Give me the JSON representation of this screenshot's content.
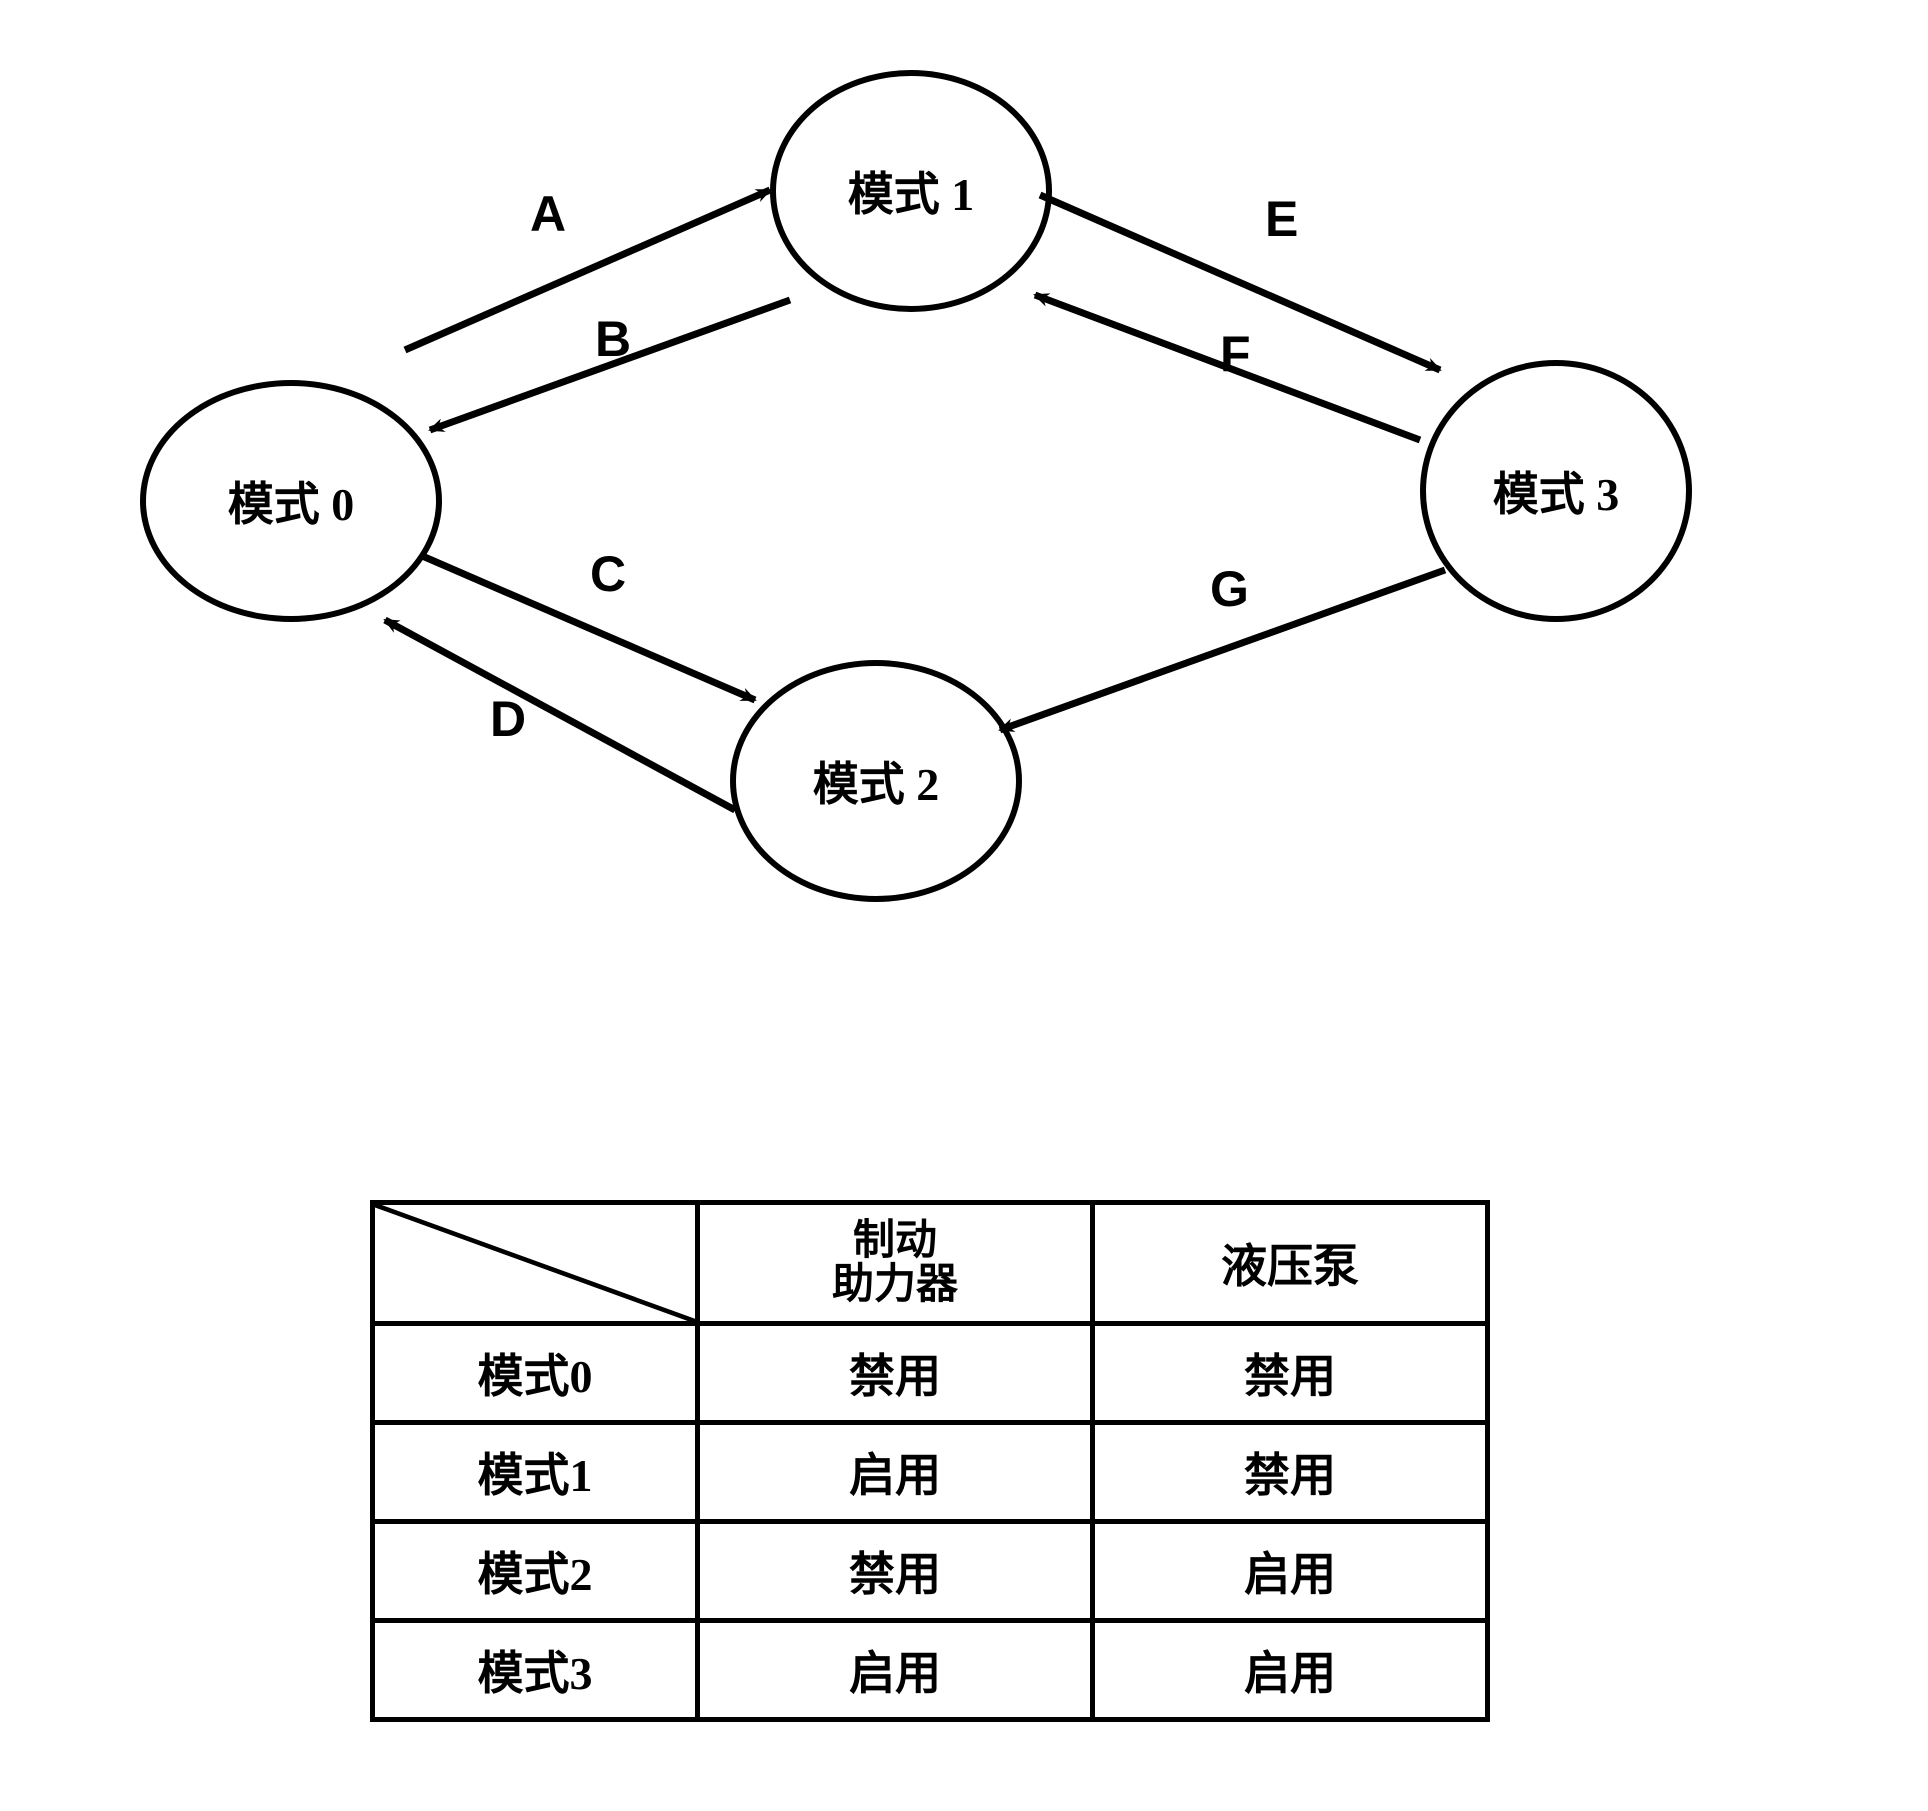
{
  "states": {
    "mode0": "模式 0",
    "mode1": "模式 1",
    "mode2": "模式 2",
    "mode3": "模式 3"
  },
  "edges": {
    "A": "A",
    "B": "B",
    "C": "C",
    "D": "D",
    "E": "E",
    "F": "F",
    "G": "G"
  },
  "table": {
    "headers": {
      "col1_blank": "",
      "brake_booster_line1": "制动",
      "brake_booster_line2": "助力器",
      "hydraulic_pump": "液压泵"
    },
    "rows": [
      {
        "mode": "模式0",
        "booster": "禁用",
        "pump": "禁用"
      },
      {
        "mode": "模式1",
        "booster": "启用",
        "pump": "禁用"
      },
      {
        "mode": "模式2",
        "booster": "禁用",
        "pump": "启用"
      },
      {
        "mode": "模式3",
        "booster": "启用",
        "pump": "启用"
      }
    ]
  },
  "chart_data": {
    "type": "state_diagram_with_table",
    "nodes": [
      "模式0",
      "模式1",
      "模式2",
      "模式3"
    ],
    "transitions": [
      {
        "label": "A",
        "from": "模式0",
        "to": "模式1"
      },
      {
        "label": "B",
        "from": "模式1",
        "to": "模式0"
      },
      {
        "label": "C",
        "from": "模式0",
        "to": "模式2"
      },
      {
        "label": "D",
        "from": "模式2",
        "to": "模式0"
      },
      {
        "label": "E",
        "from": "模式1",
        "to": "模式3"
      },
      {
        "label": "F",
        "from": "模式3",
        "to": "模式1"
      },
      {
        "label": "G",
        "from": "模式3",
        "to": "模式2"
      }
    ],
    "mode_table": {
      "columns": [
        "制动助力器",
        "液压泵"
      ],
      "rows": {
        "模式0": [
          "禁用",
          "禁用"
        ],
        "模式1": [
          "启用",
          "禁用"
        ],
        "模式2": [
          "禁用",
          "启用"
        ],
        "模式3": [
          "启用",
          "启用"
        ]
      }
    }
  }
}
